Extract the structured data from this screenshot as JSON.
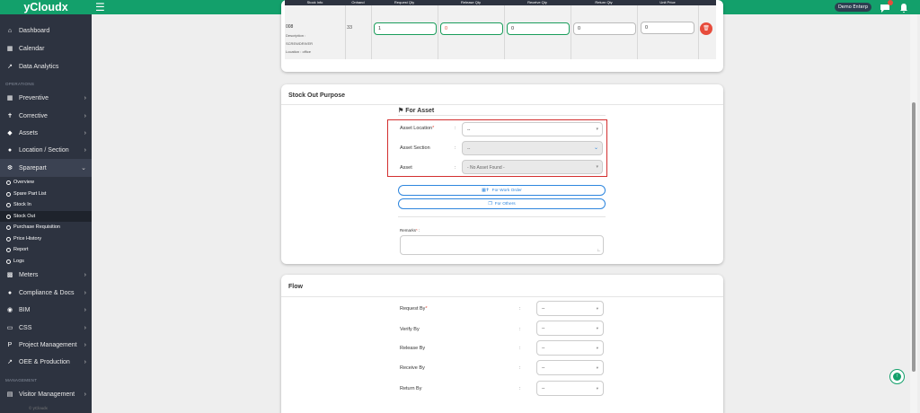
{
  "app": {
    "brand": "yCloudx",
    "demo_badge": "Demo Enterp",
    "notification_count": "99+"
  },
  "sidebar": {
    "top_items": [
      {
        "label": "Dashboard",
        "icon": "home-icon"
      },
      {
        "label": "Calendar",
        "icon": "calendar-icon"
      },
      {
        "label": "Data Analytics",
        "icon": "chart-line-icon"
      }
    ],
    "section_operations": "OPERATIONS",
    "ops_items": [
      {
        "label": "Preventive",
        "icon": "calendar-check-icon"
      },
      {
        "label": "Corrective",
        "icon": "wrench-icon"
      },
      {
        "label": "Assets",
        "icon": "tag-icon"
      },
      {
        "label": "Location / Section",
        "icon": "location-icon"
      },
      {
        "label": "Sparepart",
        "icon": "sparepart-icon"
      }
    ],
    "sparepart_sub": [
      "Overview",
      "Spare Part List",
      "Stock In",
      "Stock Out",
      "Purchase Requisition",
      "Price History",
      "Report",
      "Logs"
    ],
    "more_items": [
      {
        "label": "Meters",
        "icon": "car-icon"
      },
      {
        "label": "Compliance & Docs",
        "icon": "circle-icon"
      },
      {
        "label": "BIM",
        "icon": "bim-icon"
      },
      {
        "label": "CSS",
        "icon": "monitor-icon"
      },
      {
        "label": "Project Management",
        "icon": "project-icon"
      },
      {
        "label": "OEE & Production",
        "icon": "chart-line-icon"
      }
    ],
    "section_management": "MANAGEMENT",
    "mgmt_items": [
      {
        "label": "Visitor Management",
        "icon": "id-card-icon"
      }
    ],
    "footer": "© yCloudx"
  },
  "stock_table": {
    "headers": [
      "Stock Info",
      "Onhand",
      "Request Qty",
      "Release Qty",
      "Receive Qty",
      "Return Qty",
      "Unit Price"
    ],
    "row": {
      "code": "008",
      "description": "Description :",
      "desc_value": "SCREWDRIVER",
      "location": "Location : office",
      "onhand": "33",
      "request_qty": "1",
      "release_qty": "0",
      "receive_qty": "0",
      "return_qty": "0",
      "unit_price": "0",
      "delete_label": "🗑"
    }
  },
  "purpose": {
    "title": "Stock Out Purpose",
    "for_asset": "For Asset",
    "asset_location_label": "Asset Location",
    "asset_location_value": "--",
    "asset_section_label": "Asset Section",
    "asset_section_value": "--",
    "asset_label": "Asset",
    "asset_value": "- No Asset Found -",
    "for_work_order": "For Work Order",
    "for_others": "For Others",
    "remarks_label": "Remarks"
  },
  "flow": {
    "title": "Flow",
    "rows": [
      {
        "label": "Request By",
        "required": true,
        "value": "--"
      },
      {
        "label": "Verify By",
        "required": false,
        "value": "--"
      },
      {
        "label": "Release By",
        "required": false,
        "value": "--"
      },
      {
        "label": "Receive By",
        "required": false,
        "value": "--"
      },
      {
        "label": "Return By",
        "required": false,
        "value": "--"
      }
    ]
  }
}
